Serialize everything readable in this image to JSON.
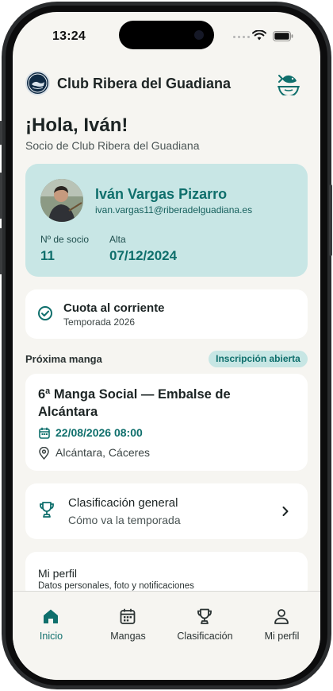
{
  "status_bar": {
    "time": "13:24"
  },
  "header": {
    "club_name": "Club Ribera del Guadiana"
  },
  "greeting": {
    "title": "¡Hola, Iván!",
    "subtitle": "Socio de Club Ribera del Guadiana"
  },
  "member": {
    "name": "Iván Vargas Pizarro",
    "email": "ivan.vargas11@riberadelguadiana.es",
    "number_label": "Nº de socio",
    "number": "11",
    "since_label": "Alta",
    "since": "07/12/2024"
  },
  "quota": {
    "title": "Cuota al corriente",
    "season": "Temporada 2026"
  },
  "next_event": {
    "section_title": "Próxima manga",
    "badge": "Inscripción abierta",
    "title": "6ª Manga Social — Embalse de Alcántara",
    "datetime": "22/08/2026 08:00",
    "location": "Alcántara, Cáceres"
  },
  "ranking": {
    "title": "Clasificación general",
    "subtitle": "Cómo va la temporada"
  },
  "profile": {
    "title": "Mi perfil",
    "subtitle": "Datos personales, foto y notificaciones"
  },
  "tabs": [
    {
      "label": "Inicio",
      "icon": "home-icon",
      "active": true
    },
    {
      "label": "Mangas",
      "icon": "calendar-icon",
      "active": false
    },
    {
      "label": "Clasificación",
      "icon": "trophy-icon",
      "active": false
    },
    {
      "label": "Mi perfil",
      "icon": "person-icon",
      "active": false
    }
  ],
  "colors": {
    "accent": "#0f6f6c",
    "card_tint": "#c8e6e5",
    "background": "#f6f5f1"
  }
}
